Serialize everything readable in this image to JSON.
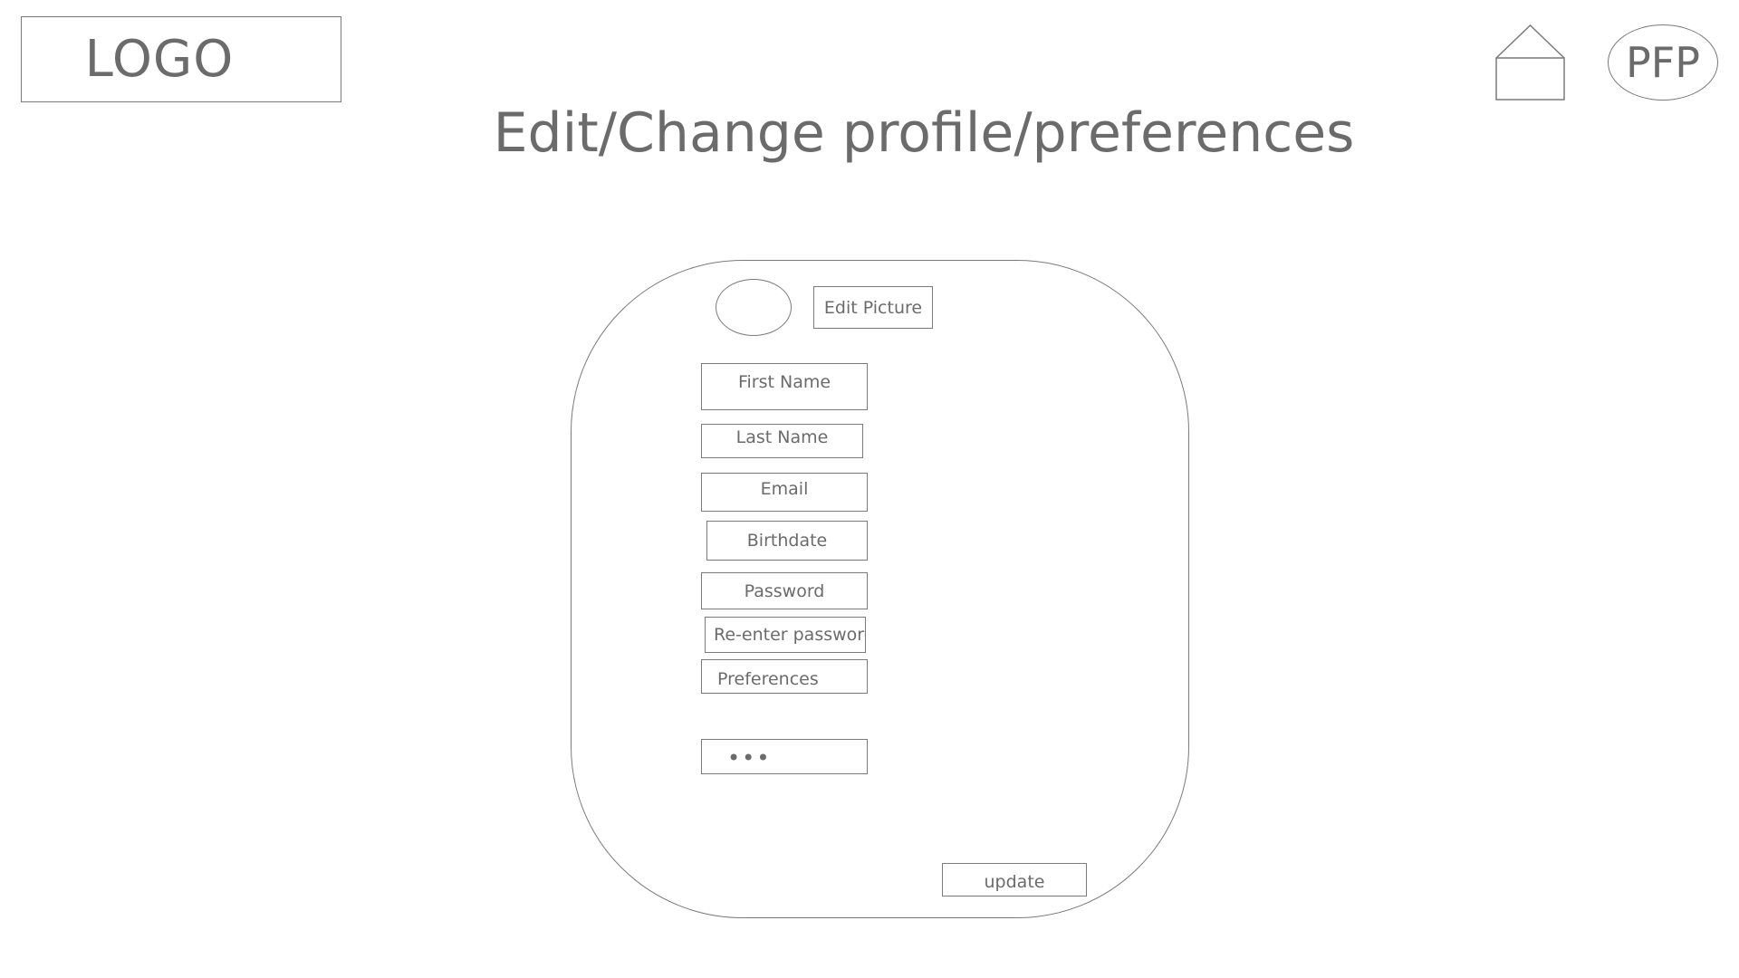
{
  "header": {
    "logo_text": "LOGO",
    "home_icon": "house-icon",
    "profile_button_label": "PFP"
  },
  "page": {
    "title": "Edit/Change profile/preferences"
  },
  "profile_card": {
    "avatar_icon": "profile-picture-placeholder",
    "edit_picture_label": "Edit Picture",
    "fields": {
      "first_name": "First Name",
      "last_name": "Last Name",
      "email": "Email",
      "birthdate": "Birthdate",
      "password": "Password",
      "reenter_password": "Re-enter password",
      "preferences": "Preferences",
      "more": "•••"
    },
    "update_label": "update"
  }
}
